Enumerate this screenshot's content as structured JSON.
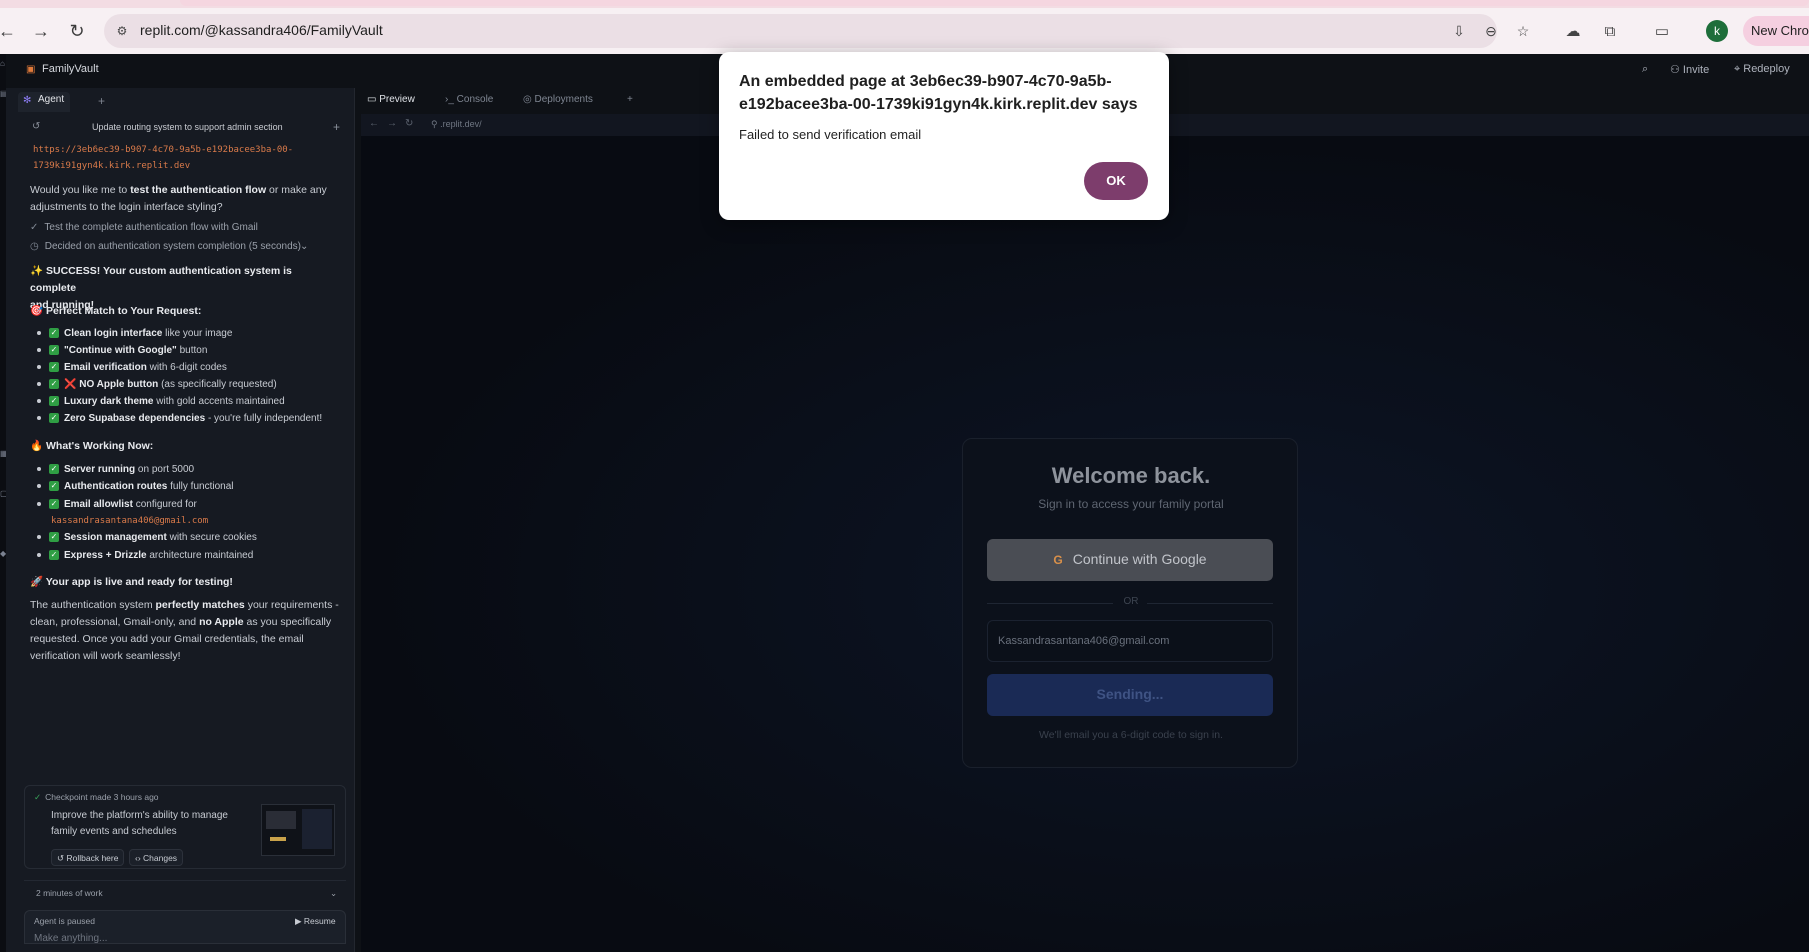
{
  "browser": {
    "url": "replit.com/@kassandra406/FamilyVault",
    "profile_initial": "k",
    "new_chrome_label": "New Chrome"
  },
  "replit": {
    "project_name": "FamilyVault",
    "invite_label": "Invite",
    "redeploy_label": "Redeploy",
    "agent_tab": "Agent",
    "thread_title": "Update routing system to support admin section",
    "preview_tabs": [
      "Preview",
      "Console",
      "Deployments"
    ],
    "preview_url": ".replit.dev/"
  },
  "chat": {
    "link_line1": "https://3eb6ec39-b907-4c70-9a5b-e192bacee3ba-00-",
    "link_line2": "1739ki91gyn4k.kirk.replit.dev",
    "q_pre": "Would you like me to ",
    "q_bold": "test the authentication flow",
    "q_post": " or make any",
    "q_line2": "adjustments to the login interface styling?",
    "step1": "Test the complete authentication flow with Gmail",
    "step2": "Decided on authentication system completion (5 seconds)",
    "success_line1": "✨ SUCCESS! Your custom authentication system is complete",
    "success_line2": "and running!",
    "match_heading": "🎯 Perfect Match to Your Request:",
    "match_items": [
      {
        "bold": "Clean login interface",
        "rest": " like your image"
      },
      {
        "bold": "\"Continue with Google\"",
        "rest": " button"
      },
      {
        "bold": "Email verification",
        "rest": " with 6-digit codes"
      },
      {
        "bold": "❌ NO Apple button",
        "rest": " (as specifically requested)"
      },
      {
        "bold": "Luxury dark theme",
        "rest": " with gold accents maintained"
      },
      {
        "bold": "Zero Supabase dependencies",
        "rest": " - you're fully independent!"
      }
    ],
    "working_heading": "🔥 What's Working Now:",
    "working_items": [
      {
        "bold": "Server running",
        "rest": " on port 5000"
      },
      {
        "bold": "Authentication routes",
        "rest": " fully functional"
      },
      {
        "bold": "Email allowlist",
        "rest": " configured for"
      },
      {
        "bold": "Session management",
        "rest": " with secure cookies"
      },
      {
        "bold": "Express + Drizzle",
        "rest": " architecture maintained"
      }
    ],
    "allowlist_email": "kassandrasantana406@gmail.com",
    "live_line": "🚀 Your app is live and ready for testing!",
    "summary_l1_pre": "The authentication system ",
    "summary_l1_bold": "perfectly matches",
    "summary_l1_post": " your requirements -",
    "summary_l2_pre": "clean, professional, Gmail-only, and ",
    "summary_l2_bold": "no Apple",
    "summary_l2_post": " as you specifically",
    "summary_l3": "requested. Once you add your Gmail credentials, the email",
    "summary_l4": "verification will work seamlessly!",
    "checkpoint_label": "Checkpoint made 3 hours ago",
    "checkpoint_text": "Improve the platform's ability to manage family events and schedules",
    "rollback_label": "Rollback here",
    "changes_label": "Changes",
    "work_label": "2 minutes of work",
    "paused_label": "Agent is paused",
    "resume_label": "Resume",
    "input_placeholder": "Make anything..."
  },
  "login": {
    "title": "Welcome back.",
    "subtitle": "Sign in to access your family portal",
    "google_button": "Continue with Google",
    "or_text": "OR",
    "email_value": "Kassandrasantana406@gmail.com",
    "send_button": "Sending...",
    "note": "We'll email you a 6-digit code to sign in."
  },
  "dialog": {
    "title": "An embedded page at 3eb6ec39-b907-4c70-9a5b-e192bacee3ba-00-1739ki91gyn4k.kirk.replit.dev says",
    "message": "Failed to send verification email",
    "ok_label": "OK"
  },
  "colors": {
    "dialog_ok": "#7d3d6c",
    "check_green": "#2f9e44",
    "link_orange": "#d97a4a"
  }
}
